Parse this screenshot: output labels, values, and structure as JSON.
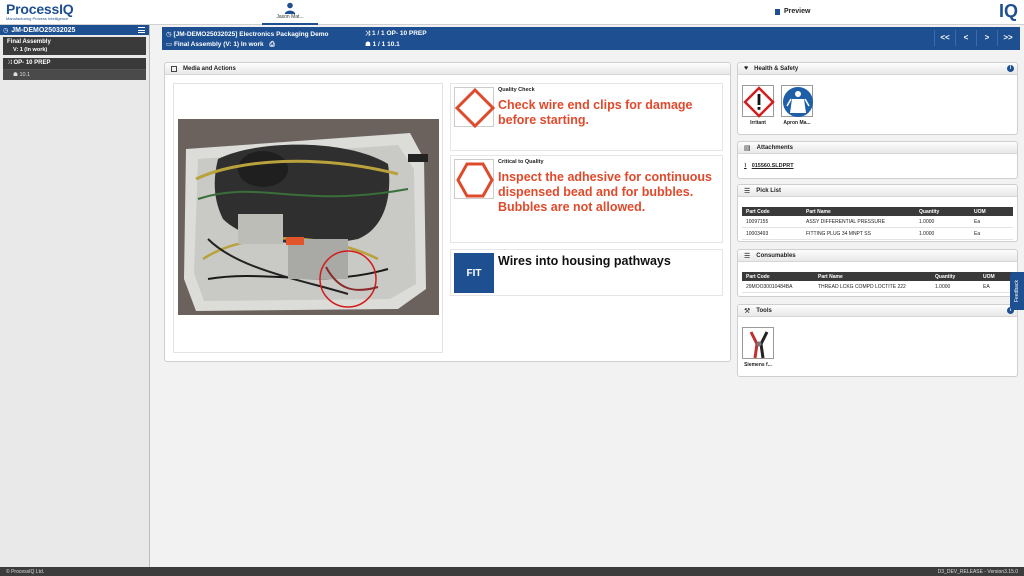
{
  "app": {
    "logo_name": "ProcessIQ",
    "logo_sub": "Manufacturing Process Intelligence",
    "user_name": "Jason Mat...",
    "preview_label": "Preview",
    "iq_mark": "IQ",
    "accent": "#1e4f91",
    "alert_color": "#e04a2c"
  },
  "sidebar": {
    "job": "JM-DEMO25032025",
    "items": [
      {
        "title": "Final Assembly",
        "line2": "V: 1  (In work)"
      },
      {
        "title": "OP- 10 PREP",
        "sub": "10.1"
      }
    ]
  },
  "header": {
    "job_title": "[JM-DEMO25032025] Electronics Packaging Demo",
    "assembly": "Final Assembly  (V: 1)  In work",
    "op": "1 / 1 OP- 10 PREP",
    "step": "1 / 1 10.1",
    "nav": [
      "<<",
      "<",
      ">",
      ">>"
    ]
  },
  "media": {
    "title": "Media and Actions",
    "cards": [
      {
        "title": "Quality Check",
        "text": "Check wire end clips for damage before starting."
      },
      {
        "title": "Critical to Quality",
        "text": "Inspect the adhesive for continuous dispensed bead and for bubbles. Bubbles are not allowed."
      },
      {
        "icon_text": "FIT",
        "text": "Wires into housing pathways"
      }
    ]
  },
  "health_safety": {
    "title": "Health & Safety",
    "items": [
      {
        "label": "Irritant",
        "icon": "irritant-hazard-icon"
      },
      {
        "label": "Apron Ma...",
        "icon": "apron-mandatory-icon"
      }
    ]
  },
  "attachments": {
    "title": "Attachments",
    "file": "015560.SLDPRT"
  },
  "pick_list": {
    "title": "Pick List",
    "columns": [
      "Part Code",
      "Part Name",
      "Quantity",
      "UOM"
    ],
    "rows": [
      [
        "10097155",
        "ASSY DIFFERENTIAL PRESSURE",
        "1.0000",
        "Ea"
      ],
      [
        "10003493",
        "FITTING PLUG 34 MNPT SS",
        "1.0000",
        "Ea"
      ]
    ]
  },
  "consumables": {
    "title": "Consumables",
    "columns": [
      "Part Code",
      "Part Name",
      "Quantity",
      "UOM"
    ],
    "rows": [
      [
        "29MOO30010484BA",
        "THREAD LCKG COMPD LOCTITE 222",
        "1.0000",
        "EA"
      ]
    ]
  },
  "tools": {
    "title": "Tools",
    "items": [
      {
        "label": "Siemens f...",
        "icon": "pliers-icon"
      }
    ]
  },
  "feedback_label": "Feedback",
  "footer": {
    "left": "© ProcessIQ Ltd.",
    "right": "D3_DEV_RELEASE - Version3.15.0"
  }
}
